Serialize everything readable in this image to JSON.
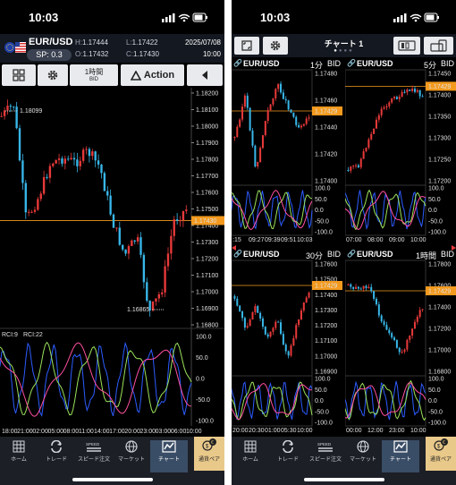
{
  "colors": {
    "bull": "#e8393a",
    "bear": "#38b6e8",
    "current_price": "#f39a1e",
    "panel_bg": "#000000"
  },
  "left": {
    "status": {
      "time": "10:03"
    },
    "header": {
      "pair": "EUR/USD",
      "spread": "SP: 0.3",
      "high_label": "H:",
      "high": "1.17444",
      "low_label": "L:",
      "low": "1.17422",
      "open_label": "O:",
      "open": "1.17432",
      "close_label": "C:",
      "close": "1.17430",
      "date": "2025/07/08",
      "clock": "10:00"
    },
    "toolbar": {
      "timeframe": "1時間",
      "price_type": "BID",
      "action": "Action"
    },
    "chart": {
      "price_ticks": [
        "1.18200",
        "1.18100",
        "1.18000",
        "1.17900",
        "1.17800",
        "1.17700",
        "1.17600",
        "1.17500",
        "1.17400",
        "1.17300",
        "1.17200",
        "1.17100",
        "1.17000",
        "1.16900",
        "1.16800"
      ],
      "current_price": "1.17430",
      "high_marker": "1.18099",
      "low_marker": "1.16865",
      "legend": [
        "RCI:9",
        "RCI:22"
      ],
      "rci_ticks": [
        "100.0",
        "50.0",
        "0.0",
        "-50.0",
        "-100.0"
      ],
      "time_ticks": [
        "18:00",
        "21:00",
        "02:00",
        "05:00",
        "08:00",
        "11:00",
        "14:00",
        "17:00",
        "20:00",
        "23:00",
        "03:00",
        "06:00",
        "10:00"
      ]
    }
  },
  "right": {
    "status": {
      "time": "10:03"
    },
    "header": {
      "title": "チャート 1"
    },
    "panels": [
      {
        "pair": "EUR/USD",
        "timeframe": "1分",
        "price_type": "BID",
        "price_ticks": [
          "1.17480",
          "1.17460",
          "1.17440",
          "1.17420",
          "1.17400"
        ],
        "current_price": "1.17429",
        "rci_ticks": [
          "100.0",
          "50.0",
          "0.0",
          "-50.0",
          "-100.0"
        ],
        "time_ticks": [
          ":15",
          "09:27",
          "09:39",
          "09:51",
          "10:03"
        ]
      },
      {
        "pair": "EUR/USD",
        "timeframe": "5分",
        "price_type": "BID",
        "price_ticks": [
          "1.17450",
          "1.17400",
          "1.17350",
          "1.17300",
          "1.17250",
          "1.17200"
        ],
        "current_price": "1.17429",
        "rci_ticks": [
          "100.0",
          "50.0",
          "0.0",
          "-50.0",
          "-100.0"
        ],
        "time_ticks": [
          "07:00",
          "08:00",
          "09:00",
          "10:00"
        ]
      },
      {
        "pair": "EUR/USD",
        "timeframe": "30分",
        "price_type": "BID",
        "price_ticks": [
          "1.17600",
          "1.17500",
          "1.17400",
          "1.17300",
          "1.17200",
          "1.17100",
          "1.17000",
          "1.16900"
        ],
        "current_price": "1.17429",
        "rci_ticks": [
          "100.0",
          "50.0",
          "0.0",
          "-50.0",
          "-100.0"
        ],
        "time_ticks": [
          "20:00",
          "20:30",
          "01:00",
          "05:30",
          "10:00"
        ]
      },
      {
        "pair": "EUR/USD",
        "timeframe": "1時間",
        "price_type": "BID",
        "price_ticks": [
          "1.17800",
          "1.17600",
          "1.17400",
          "1.17200",
          "1.17000",
          "1.16800"
        ],
        "current_price": "1.17429",
        "rci_ticks": [
          "100.0",
          "50.0",
          "0.0",
          "-50.0",
          "-100.0"
        ],
        "time_ticks": [
          "00:00",
          "12:00",
          "23:00",
          "10:00"
        ]
      }
    ]
  },
  "nav": {
    "items": [
      "ホーム",
      "トレード",
      "スピード注文",
      "マーケット",
      "チャート"
    ],
    "pair_button": "通貨ペア"
  }
}
